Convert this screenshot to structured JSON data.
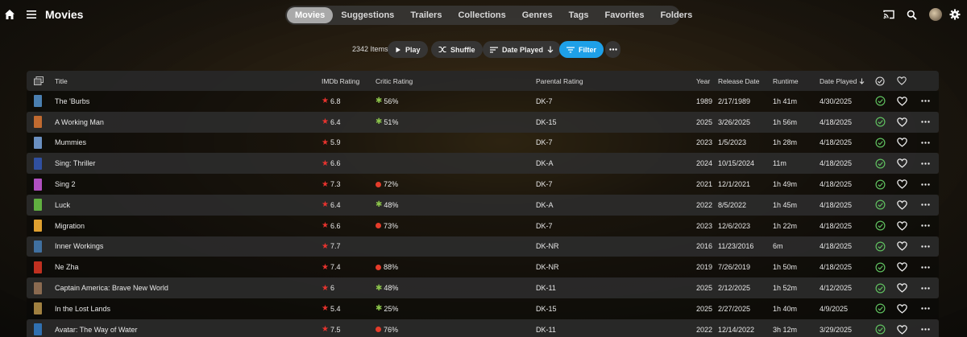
{
  "header": {
    "title": "Movies",
    "tabs": [
      {
        "label": "Movies",
        "active": true
      },
      {
        "label": "Suggestions",
        "active": false
      },
      {
        "label": "Trailers",
        "active": false
      },
      {
        "label": "Collections",
        "active": false
      },
      {
        "label": "Genres",
        "active": false
      },
      {
        "label": "Tags",
        "active": false
      },
      {
        "label": "Favorites",
        "active": false
      },
      {
        "label": "Folders",
        "active": false
      }
    ]
  },
  "toolbar": {
    "item_count": "2342 Items",
    "play_label": "Play",
    "shuffle_label": "Shuffle",
    "sort_label": "Date Played",
    "filter_label": "Filter"
  },
  "columns": {
    "title": "Title",
    "imdb": "IMDb Rating",
    "critic": "Critic Rating",
    "parental": "Parental Rating",
    "year": "Year",
    "release": "Release Date",
    "runtime": "Runtime",
    "played": "Date Played"
  },
  "colors": {
    "accent": "#1ea0e8",
    "played_check": "#5fbf5f",
    "imdb_star": "#e8332e",
    "rotten_splat": "#8bc34a",
    "fresh_tomato": "#e53c2a"
  },
  "rows": [
    {
      "title": "The 'Burbs",
      "imdb": "6.8",
      "critic": "56%",
      "critic_icon": "splat",
      "parental": "DK-7",
      "year": "1989",
      "release": "2/17/1989",
      "runtime": "1h 41m",
      "played": "4/30/2025",
      "thumb": "#4a7fb0"
    },
    {
      "title": "A Working Man",
      "imdb": "6.4",
      "critic": "51%",
      "critic_icon": "splat",
      "parental": "DK-15",
      "year": "2025",
      "release": "3/26/2025",
      "runtime": "1h 56m",
      "played": "4/18/2025",
      "thumb": "#c06a30"
    },
    {
      "title": "Mummies",
      "imdb": "5.9",
      "critic": "",
      "critic_icon": "",
      "parental": "DK-7",
      "year": "2023",
      "release": "1/5/2023",
      "runtime": "1h 28m",
      "played": "4/18/2025",
      "thumb": "#6a8fc0"
    },
    {
      "title": "Sing: Thriller",
      "imdb": "6.6",
      "critic": "",
      "critic_icon": "",
      "parental": "DK-A",
      "year": "2024",
      "release": "10/15/2024",
      "runtime": "11m",
      "played": "4/18/2025",
      "thumb": "#3050a0"
    },
    {
      "title": "Sing 2",
      "imdb": "7.3",
      "critic": "72%",
      "critic_icon": "tomato",
      "parental": "DK-7",
      "year": "2021",
      "release": "12/1/2021",
      "runtime": "1h 49m",
      "played": "4/18/2025",
      "thumb": "#b050c0"
    },
    {
      "title": "Luck",
      "imdb": "6.4",
      "critic": "48%",
      "critic_icon": "splat",
      "parental": "DK-A",
      "year": "2022",
      "release": "8/5/2022",
      "runtime": "1h 45m",
      "played": "4/18/2025",
      "thumb": "#60b040"
    },
    {
      "title": "Migration",
      "imdb": "6.6",
      "critic": "73%",
      "critic_icon": "tomato",
      "parental": "DK-7",
      "year": "2023",
      "release": "12/6/2023",
      "runtime": "1h 22m",
      "played": "4/18/2025",
      "thumb": "#e0a030"
    },
    {
      "title": "Inner Workings",
      "imdb": "7.7",
      "critic": "",
      "critic_icon": "",
      "parental": "DK-NR",
      "year": "2016",
      "release": "11/23/2016",
      "runtime": "6m",
      "played": "4/18/2025",
      "thumb": "#4070a0"
    },
    {
      "title": "Ne Zha",
      "imdb": "7.4",
      "critic": "88%",
      "critic_icon": "tomato",
      "parental": "DK-NR",
      "year": "2019",
      "release": "7/26/2019",
      "runtime": "1h 50m",
      "played": "4/18/2025",
      "thumb": "#c03020"
    },
    {
      "title": "Captain America: Brave New World",
      "imdb": "6",
      "critic": "48%",
      "critic_icon": "splat",
      "parental": "DK-11",
      "year": "2025",
      "release": "2/12/2025",
      "runtime": "1h 52m",
      "played": "4/12/2025",
      "thumb": "#8a6a50"
    },
    {
      "title": "In the Lost Lands",
      "imdb": "5.4",
      "critic": "25%",
      "critic_icon": "splat",
      "parental": "DK-15",
      "year": "2025",
      "release": "2/27/2025",
      "runtime": "1h 40m",
      "played": "4/9/2025",
      "thumb": "#a08040"
    },
    {
      "title": "Avatar: The Way of Water",
      "imdb": "7.5",
      "critic": "76%",
      "critic_icon": "tomato",
      "parental": "DK-11",
      "year": "2022",
      "release": "12/14/2022",
      "runtime": "3h 12m",
      "played": "3/29/2025",
      "thumb": "#3070b0"
    }
  ]
}
